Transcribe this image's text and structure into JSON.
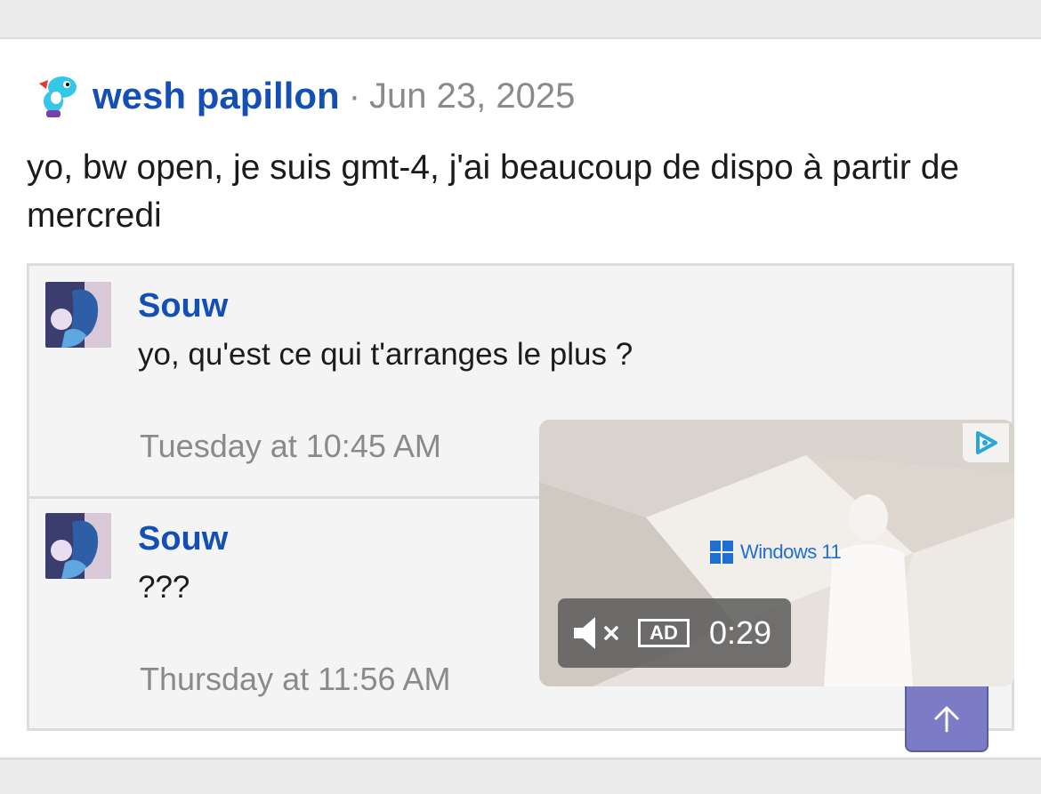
{
  "post": {
    "author": "wesh papillon",
    "separator": "·",
    "date": "Jun 23, 2025",
    "body": "yo, bw open, je suis gmt-4, j'ai beaucoup de dispo à partir de mercredi"
  },
  "replies": [
    {
      "author": "Souw",
      "text": "yo, qu'est ce qui t'arranges le plus ?",
      "time": "Tuesday at 10:45 AM"
    },
    {
      "author": "Souw",
      "text": "???",
      "time": "Thursday at 11:56 AM"
    }
  ],
  "ad": {
    "brand_text": "Windows 11",
    "ad_label": "AD",
    "countdown": "0:29",
    "muted": true
  },
  "icons": {
    "mute": "speaker-muted-icon",
    "adchoices": "adchoices-icon",
    "scroll_top": "arrow-up-icon"
  },
  "colors": {
    "link_blue": "#1450b4",
    "scroll_button": "#7b7bc6",
    "windows_blue": "#1f6fd1"
  }
}
